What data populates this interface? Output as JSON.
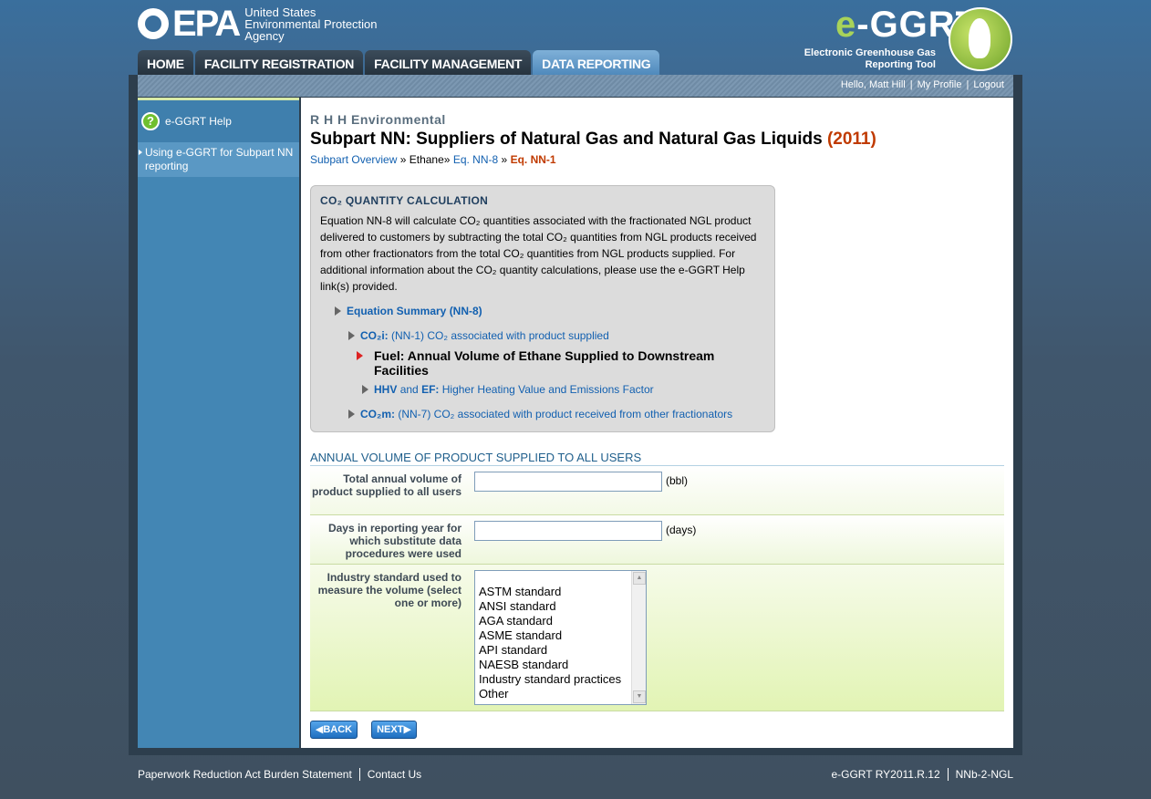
{
  "header": {
    "epa_word": "EPA",
    "agency_line1": "United States",
    "agency_line2": "Environmental Protection",
    "agency_line3": "Agency",
    "app_logo_prefix": "e",
    "app_logo_rest": "-GGRT",
    "app_sub_line1": "Electronic Greenhouse Gas",
    "app_sub_line2": "Reporting Tool"
  },
  "tabs": [
    {
      "label": "HOME"
    },
    {
      "label": "FACILITY REGISTRATION"
    },
    {
      "label": "FACILITY MANAGEMENT"
    },
    {
      "label": "DATA REPORTING",
      "active": true
    }
  ],
  "user_bar": {
    "greeting": "Hello, Matt Hill",
    "profile": "My Profile",
    "logout": "Logout"
  },
  "sidebar": {
    "help_label": "e-GGRT Help",
    "items": [
      {
        "label": "Using e-GGRT for Subpart NN reporting"
      }
    ]
  },
  "main": {
    "org": "R H H Environmental",
    "title": "Subpart NN: Suppliers of Natural Gas and Natural Gas Liquids",
    "year": "(2011)",
    "breadcrumb": {
      "overview": "Subpart Overview",
      "sep": "»",
      "ethane": "Ethane",
      "eq8": "Eq. NN-8",
      "eq1": "Eq. NN-1"
    },
    "calc": {
      "heading": "CO₂ QUANTITY CALCULATION",
      "description": "Equation NN-8 will calculate CO₂ quantities associated with the fractionated NGL product delivered to customers by subtracting the total CO₂ quantities from NGL products received from other fractionators from the total CO₂ quantities from NGL products supplied. For additional information about the CO₂ quantity calculations, please use the e-GGRT Help link(s) provided.",
      "summary": "Equation Summary (NN-8)",
      "co2i_bold": "CO₂i:",
      "co2i_text": "(NN-1) CO₂ associated with product supplied",
      "current": "Fuel: Annual Volume of Ethane Supplied to Downstream Facilities",
      "hhv_bold": "HHV",
      "hhv_and": "and",
      "ef_bold": "EF:",
      "hhv_text": "Higher Heating Value and Emissions Factor",
      "co2m_bold": "CO₂m:",
      "co2m_text": "(NN-7) CO₂ associated with product received from other fractionators"
    },
    "section_heading": "ANNUAL VOLUME OF PRODUCT SUPPLIED TO ALL USERS",
    "fields": {
      "volume_label": "Total annual volume of product supplied to all users",
      "volume_value": "",
      "volume_unit": "(bbl)",
      "days_label": "Days in reporting year for which substitute data procedures were used",
      "days_value": "",
      "days_unit": "(days)",
      "standard_label": "Industry standard used to measure the volume (select one or more)",
      "standard_options": [
        "ASTM standard",
        "ANSI standard",
        "AGA standard",
        "ASME standard",
        "API standard",
        "NAESB standard",
        "Industry standard practices",
        "Other"
      ]
    },
    "back_label": "BACK",
    "next_label": "NEXT"
  },
  "footer": {
    "paperwork": "Paperwork Reduction Act Burden Statement",
    "contact": "Contact Us",
    "version": "e-GGRT RY2011.R.12",
    "page_code": "NNb-2-NGL"
  },
  "colors": {
    "accent_blue": "#1260b0",
    "year_red": "#c03a00",
    "form_green": "#e2f4b4"
  }
}
